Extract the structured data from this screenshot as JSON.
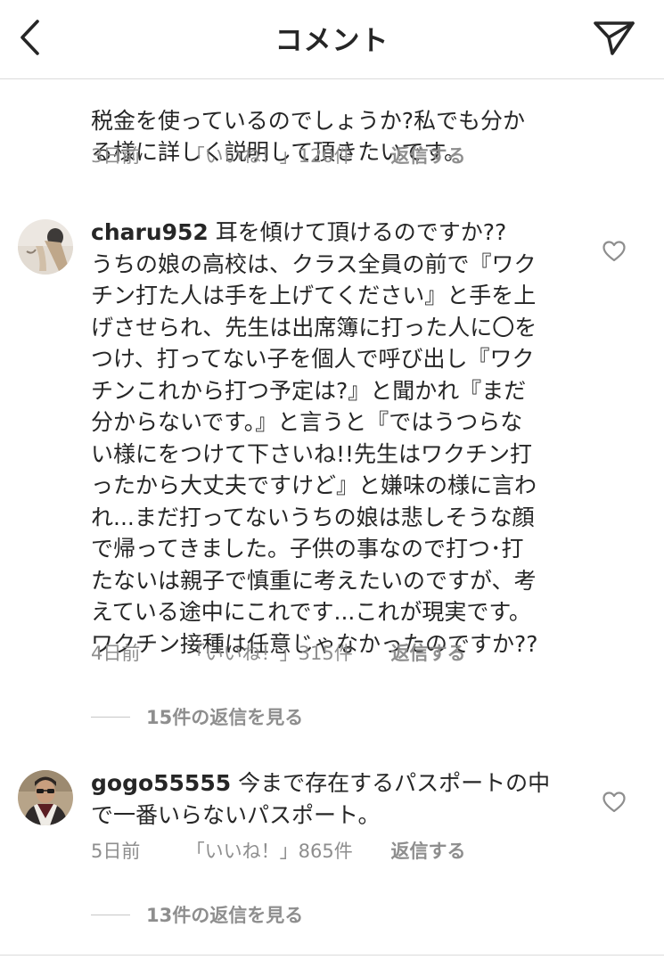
{
  "header": {
    "title": "コメント",
    "back_icon": "chevron-left-icon",
    "send_icon": "paper-plane-icon"
  },
  "comments": [
    {
      "username": "",
      "text": "税金を使っているのでしょうか?私でも分か\nる様に詳しく説明して頂きたいです。",
      "time": "3日前",
      "likes": "「いいね！」120件",
      "reply": "返信する"
    },
    {
      "username": "charu952",
      "text": " 耳を傾けて頂けるのですか??\nうちの娘の高校は、クラス全員の前で『ワク\nチン打た人は手を上げてください』と手を上\nげさせられ、先生は出席簿に打った人に〇を\nつけ、打ってない子を個人で呼び出し『ワク\nチンこれから打つ予定は?』と聞かれ『まだ\n分からないです。』と言うと『ではうつらな\nい様にをつけて下さいね!!先生はワクチン打\nったから大丈夫ですけど』と嫌味の様に言わ\nれ...まだ打ってないうちの娘は悲しそうな顔\nで帰ってきました。子供の事なので打つ･打\nたないは親子で慎重に考えたいのですが、考\nえている途中にこれです...これが現実です。\nワクチン接種は任意じゃなかったのですか??",
      "time": "4日前",
      "likes": "「いいね！」315件",
      "reply": "返信する",
      "view_replies": "15件の返信を見る"
    },
    {
      "username": "gogo55555",
      "text": " 今まで存在するパスポートの中\nで一番いらないパスポート。",
      "time": "5日前",
      "likes": "「いいね！」865件",
      "reply": "返信する",
      "view_replies": "13件の返信を見る"
    }
  ],
  "colors": {
    "text": "#262626",
    "secondary": "#8e8e8e",
    "divider": "#dbdbdb"
  }
}
